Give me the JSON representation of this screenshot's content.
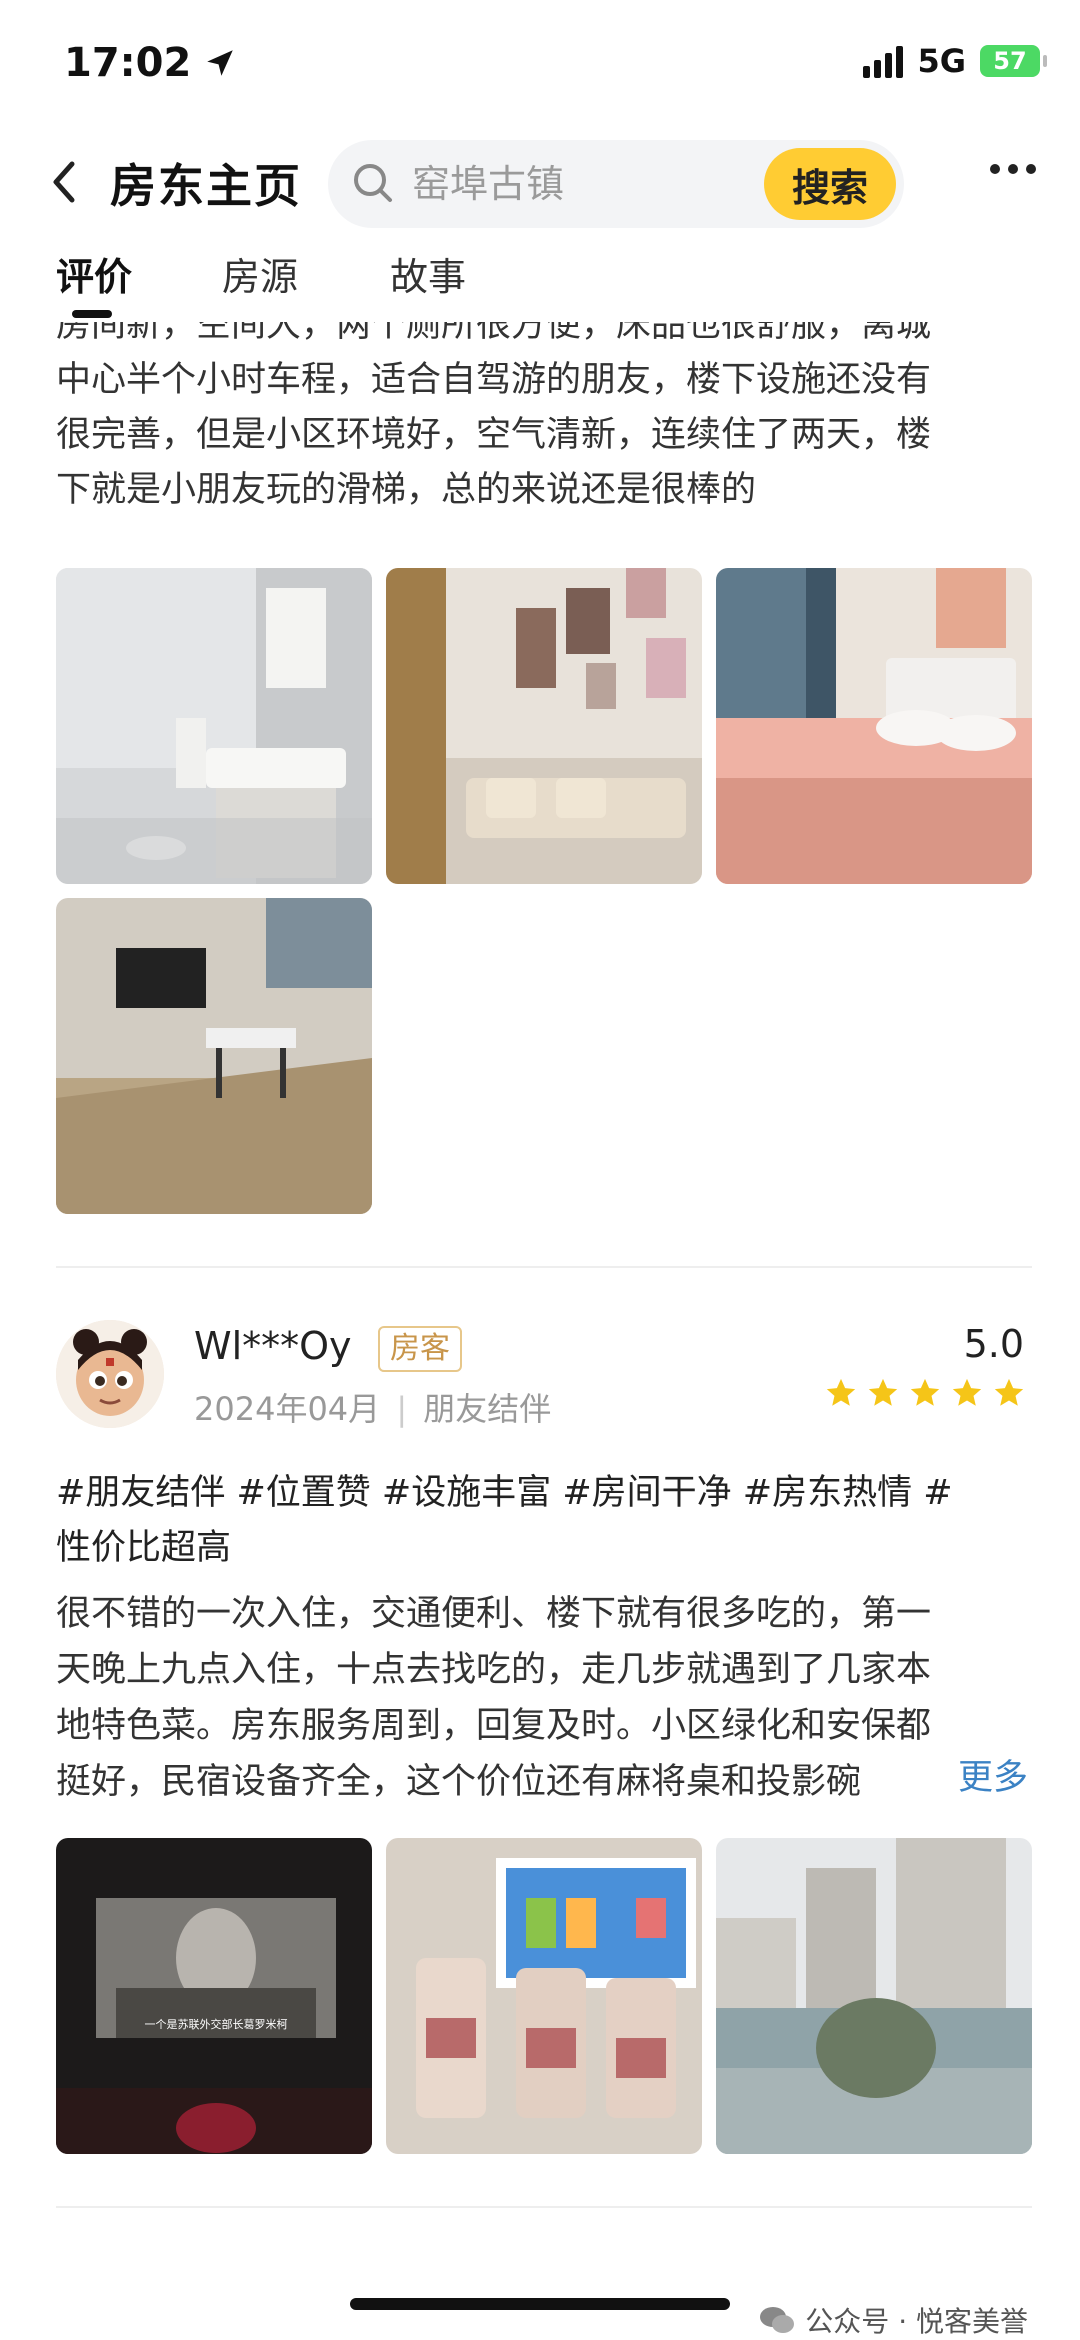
{
  "status_bar": {
    "time": "17:02",
    "network": "5G",
    "battery": "57"
  },
  "header": {
    "title": "房东主页",
    "search_placeholder": "窑埠古镇",
    "search_button": "搜索"
  },
  "tabs": [
    {
      "label": "评价"
    },
    {
      "label": "房源"
    },
    {
      "label": "故事"
    }
  ],
  "first_review": {
    "text_lines": [
      "房间新，空间大，两个厕所很方便，床品也很舒服，离城",
      "中心半个小时车程，适合自驾游的朋友，楼下设施还没有",
      "很完善，但是小区环境好，空气清新，连续住了两天，楼",
      "下就是小朋友玩的滑梯，总的来说还是很棒的"
    ]
  },
  "second_review": {
    "username": "Wl***Oy",
    "badge": "房客",
    "date": "2024年04月",
    "trip_type": "朋友结伴",
    "score": "5.0",
    "rating": 5,
    "tags_lines": [
      "#朋友结伴 #位置赞 #设施丰富 #房间干净 #房东热情 #",
      "性价比超高"
    ],
    "body_lines": [
      "很不错的一次入住，交通便利、楼下就有很多吃的，第一",
      "天晚上九点入住，十点去找吃的，走几步就遇到了几家本",
      "地特色菜。房东服务周到，回复及时。小区绿化和安保都",
      "挺好，民宿设备齐全，这个价位还有麻将桌和投影碗"
    ],
    "more_label": "更多",
    "photo_caption": "一个是苏联外交部长葛罗米柯"
  },
  "watermark": "公众号 · 悦客美誉"
}
